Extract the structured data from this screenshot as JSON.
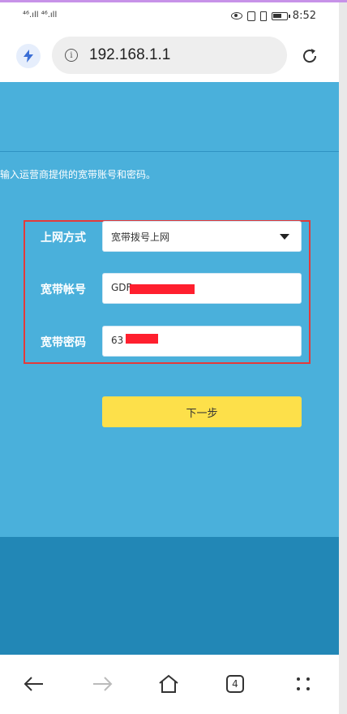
{
  "status_bar": {
    "signal_left": "⁴⁶.ıll ⁴⁶.ıll",
    "time": "8:52"
  },
  "browser": {
    "url": "192.168.1.1",
    "icons": [
      "bolt-icon",
      "info-icon",
      "reload-icon"
    ],
    "tab_count": "4"
  },
  "page": {
    "hint": "输入运营商提供的宽带账号和密码。",
    "fields": {
      "connection_label": "上网方式",
      "connection_value": "宽带拨号上网",
      "account_label": "宽带帐号",
      "account_value": "GDF",
      "password_label": "宽带密码",
      "password_value": "63"
    },
    "next_button": "下一步"
  },
  "colors": {
    "page_background": "#4ab0db",
    "footer_background": "#2287b6",
    "highlight_frame": "#e43a3a",
    "next_button": "#fde04a",
    "redaction": "#ff1f2e"
  },
  "nav_icons": [
    "back-arrow-icon",
    "forward-arrow-icon",
    "home-icon",
    "tabs-icon",
    "more-icon"
  ]
}
